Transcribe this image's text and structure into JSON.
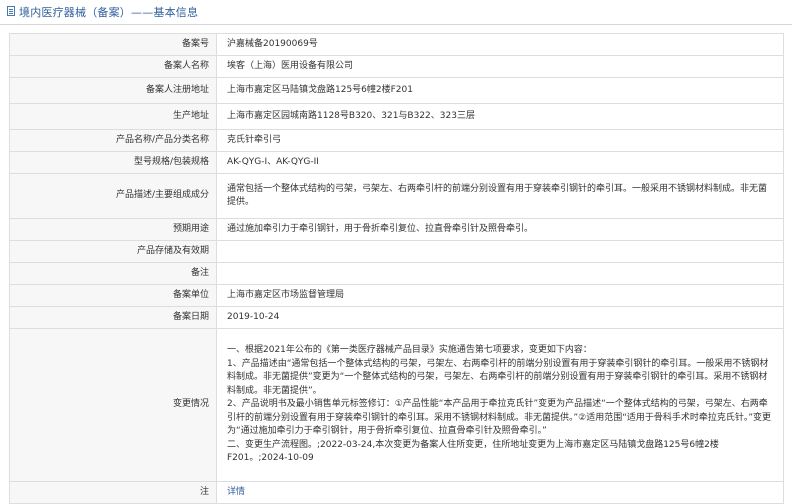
{
  "page": {
    "title": "境内医疗器械（备案）——基本信息"
  },
  "rows": [
    {
      "label": "备案号",
      "value": "沪嘉械备20190069号"
    },
    {
      "label": "备案人名称",
      "value": "埃客（上海）医用设备有限公司"
    },
    {
      "label": "备案人注册地址",
      "value": "上海市嘉定区马陆镇戈盘路125号6幢2楼F201"
    },
    {
      "label": "生产地址",
      "value": "上海市嘉定区园城南路1128号B320、321与B322、323三层"
    },
    {
      "label": "产品名称/产品分类名称",
      "value": "克氏针牵引弓"
    },
    {
      "label": "型号规格/包装规格",
      "value": "AK-QYG-I、AK-QYG-II"
    },
    {
      "label": "产品描述/主要组成成分",
      "value": "通常包括一个整体式结构的弓架，弓架左、右两牵引杆的前端分别设置有用于穿装牵引钢针的牵引耳。一般采用不锈钢材料制成。非无菌提供。"
    },
    {
      "label": "预期用途",
      "value": "通过施加牵引力于牵引钢针，用于骨折牵引复位、拉直骨牵引针及照骨牵引。"
    },
    {
      "label": "产品存储及有效期",
      "value": ""
    },
    {
      "label": "备注",
      "value": ""
    },
    {
      "label": "备案单位",
      "value": "上海市嘉定区市场监督管理局"
    },
    {
      "label": "备案日期",
      "value": "2019-10-24"
    }
  ],
  "change": {
    "label": "变更情况",
    "paragraphs": [
      "一、根据2021年公布的《第一类医疗器械产品目录》实施通告第七项要求，变更如下内容：",
      "1、产品描述由“通常包括一个整体式结构的弓架，弓架左、右两牵引杆的前端分别设置有用于穿装牵引钢针的牵引耳。一般采用不锈钢材料制成。非无菌提供”变更为“一个整体式结构的弓架，弓架左、右两牵引杆的前端分别设置有用于穿装牵引钢针的牵引耳。采用不锈钢材料制成。非无菌提供”。",
      "2、产品说明书及最小销售单元标签修订：①产品性能“本产品用于牵拉克氏针”变更为产品描述“一个整体式结构的弓架，弓架左、右两牵引杆的前端分别设置有用于穿装牵引钢针的牵引耳。采用不锈钢材料制成。非无菌提供。”②适用范围“适用于骨科手术时牵拉克氏针。”变更为“通过施加牵引力于牵引钢针，用于骨折牵引复位、拉直骨牵引针及照骨牵引。”",
      "二、变更生产流程图。;2022-03-24,本次变更为备案人住所变更，住所地址变更为上海市嘉定区马陆镇戈盘路125号6幢2楼F201。;2024-10-09"
    ]
  },
  "note": {
    "label": "注",
    "link_text": "详情"
  }
}
